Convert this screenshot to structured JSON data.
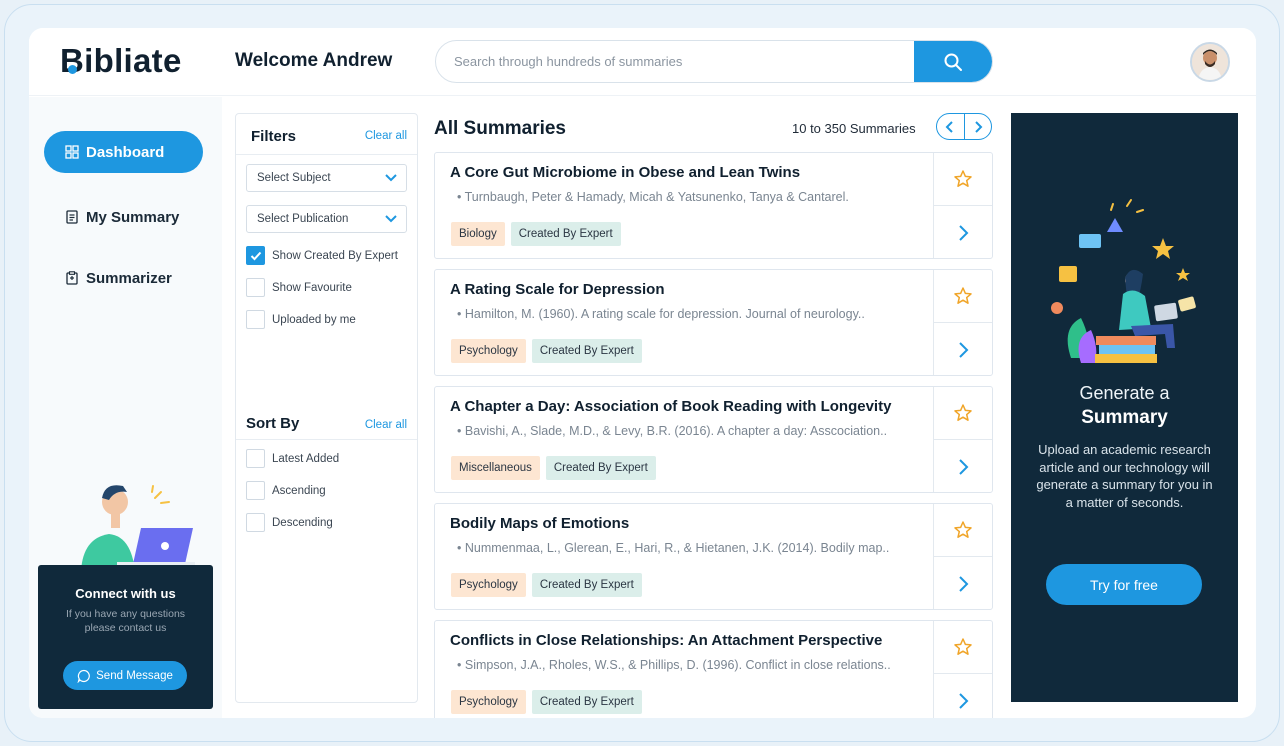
{
  "brand": {
    "logo": "Bibliate"
  },
  "header": {
    "welcome": "Welcome Andrew",
    "search_placeholder": "Search through hundreds of summaries"
  },
  "sidebar": {
    "items": [
      {
        "label": "Dashboard",
        "icon": "dashboard-grid-icon",
        "active": true
      },
      {
        "label": "My Summary",
        "icon": "document-icon",
        "active": false
      },
      {
        "label": "Summarizer",
        "icon": "clipboard-icon",
        "active": false
      }
    ],
    "connect": {
      "title": "Connect with us",
      "description": "If you have any questions please contact us",
      "button": "Send Message"
    }
  },
  "filters": {
    "title": "Filters",
    "clear": "Clear all",
    "selects": [
      "Select Subject",
      "Select Publication"
    ],
    "checkboxes": [
      {
        "label": "Show Created By Expert",
        "checked": true
      },
      {
        "label": "Show Favourite",
        "checked": false
      },
      {
        "label": "Uploaded by me",
        "checked": false
      }
    ],
    "sort_title": "Sort By",
    "sort_clear": "Clear all",
    "sort_options": [
      {
        "label": "Latest Added",
        "checked": false
      },
      {
        "label": "Ascending",
        "checked": false
      },
      {
        "label": "Descending",
        "checked": false
      }
    ]
  },
  "list": {
    "heading": "All Summaries",
    "count": "10 to 350 Summaries",
    "cards": [
      {
        "title": "A Core Gut Microbiome in Obese and Lean Twins",
        "authors": "Turnbaugh, Peter & Hamady, Micah & Yatsunenko, Tanya & Cantarel.",
        "subject": "Biology",
        "badge": "Created By Expert"
      },
      {
        "title": "A Rating Scale for Depression",
        "authors": "Hamilton, M. (1960). A rating scale for depression. Journal of neurology..",
        "subject": "Psychology",
        "badge": "Created By Expert"
      },
      {
        "title": "A Chapter a Day: Association of Book Reading with Longevity",
        "authors": "Bavishi, A., Slade, M.D., & Levy, B.R. (2016). A chapter a day: Asscociation..",
        "subject": "Miscellaneous",
        "badge": "Created By Expert"
      },
      {
        "title": "Bodily Maps of Emotions",
        "authors": "Nummenmaa, L., Glerean, E., Hari, R., & Hietanen, J.K. (2014). Bodily map..",
        "subject": "Psychology",
        "badge": "Created By Expert"
      },
      {
        "title": "Conflicts in Close Relationships: An Attachment Perspective",
        "authors": "Simpson, J.A., Rholes, W.S., & Phillips, D. (1996). Conflict in close relations..",
        "subject": "Psychology",
        "badge": "Created By Expert"
      }
    ]
  },
  "promo": {
    "line1": "Generate a",
    "line2": "Summary",
    "description": "Upload an academic research article and our technology will generate a summary for you in a matter of seconds.",
    "button": "Try for free"
  },
  "colors": {
    "accent": "#1e97e0",
    "dark_panel": "#10293b",
    "subject_tag": "#fde6d2",
    "expert_tag": "#dbeeea"
  }
}
